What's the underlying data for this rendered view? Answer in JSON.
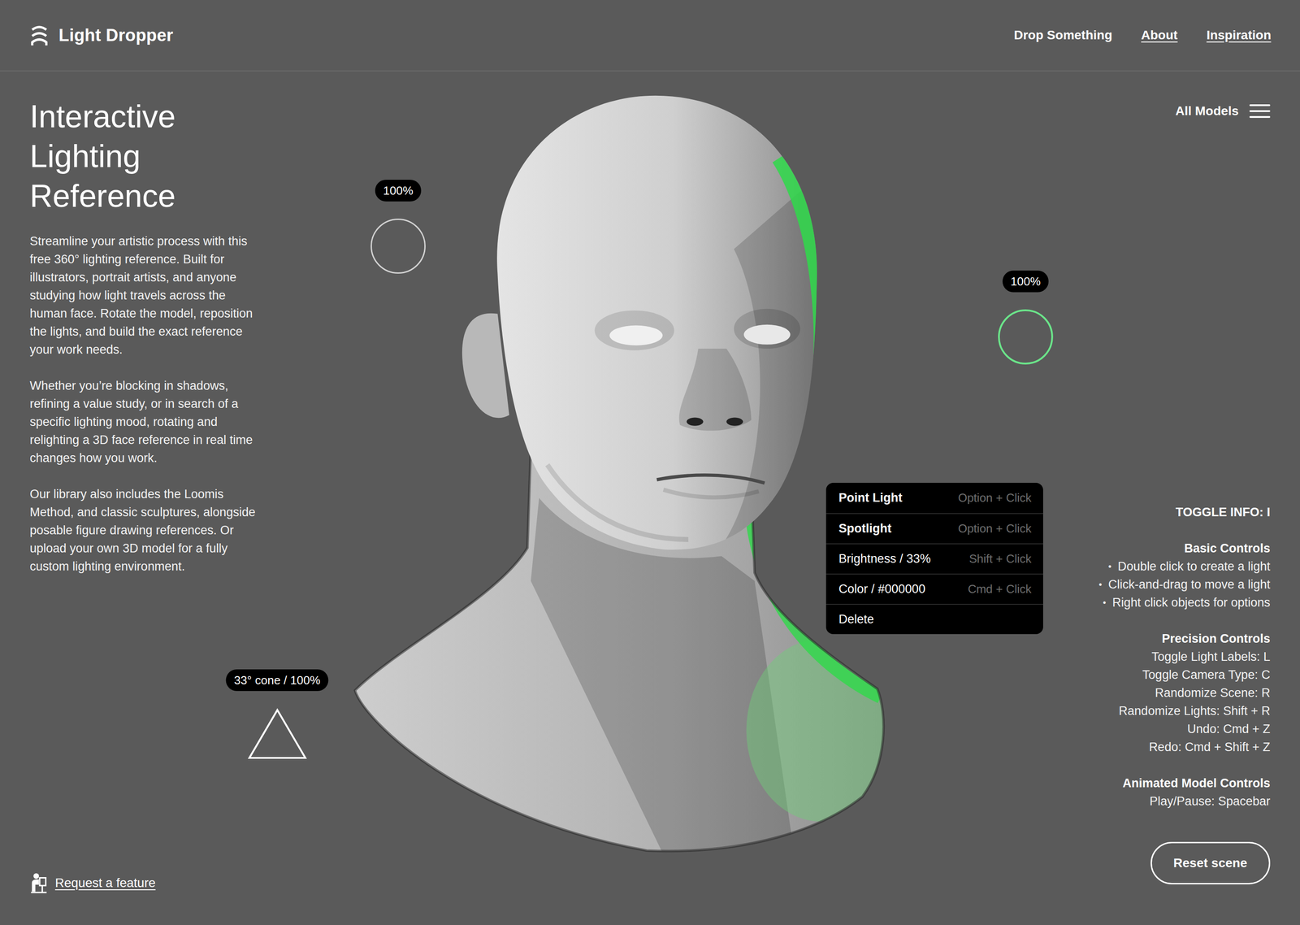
{
  "header": {
    "logo": "Light Dropper",
    "nav": [
      {
        "label": "Drop Something",
        "underlined": false
      },
      {
        "label": "About",
        "underlined": true
      },
      {
        "label": "Inspiration",
        "underlined": true
      }
    ]
  },
  "intro": {
    "title": "Interactive Lighting Reference",
    "paragraphs": [
      "Streamline your artistic process with this free 360° lighting reference. Built for illustrators, portrait artists, and anyone studying how light travels across the human face. Rotate the model, reposition the lights, and build the exact reference your work needs.",
      "Whether you’re blocking in shadows, refining a value study, or in search of a specific lighting mood, rotating and relighting a 3D face reference in real time changes how you work.",
      "Our library also includes the Loomis Method, and classic sculptures, alongside posable figure drawing references. Or upload your own 3D model for a fully custom lighting environment."
    ]
  },
  "models_menu": {
    "label": "All Models"
  },
  "lights": [
    {
      "kind": "point",
      "label": "100%",
      "selected": false,
      "color": "#d2d2d2"
    },
    {
      "kind": "point",
      "label": "100%",
      "selected": true,
      "color": "#6be58a"
    },
    {
      "kind": "spot",
      "label": "33° cone / 100%",
      "selected": false,
      "color": "#ffffff"
    }
  ],
  "context_menu": {
    "items": [
      {
        "label": "Point Light",
        "shortcut": "Option + Click",
        "emphasis": true
      },
      {
        "label": "Spotlight",
        "shortcut": "Option + Click",
        "emphasis": true
      },
      {
        "label": "Brightness / 33%",
        "shortcut": "Shift + Click",
        "emphasis": false
      },
      {
        "label": "Color / #000000",
        "shortcut": "Cmd + Click",
        "emphasis": false
      },
      {
        "label": "Delete",
        "emphasis": false
      }
    ]
  },
  "info": {
    "toggle": "TOGGLE INFO: I",
    "bullet": "•",
    "sections": [
      {
        "title": "Basic Controls",
        "bulleted": true,
        "items": [
          "Double click to create a light",
          "Click-and-drag to move a light",
          "Right click objects for options"
        ]
      },
      {
        "title": "Precision Controls",
        "bulleted": false,
        "items": [
          "Toggle Light Labels: L",
          "Toggle Camera Type: C",
          "Randomize Scene: R",
          "Randomize Lights: Shift + R",
          "Undo: Cmd + Z",
          "Redo: Cmd + Shift + Z"
        ]
      },
      {
        "title": "Animated Model Controls",
        "bulleted": false,
        "items": [
          "Play/Pause: Spacebar"
        ]
      }
    ]
  },
  "reset_button": "Reset scene",
  "request_feature": "Request a feature"
}
